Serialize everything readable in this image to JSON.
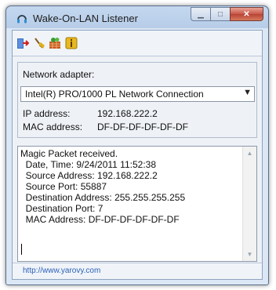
{
  "window": {
    "title": "Wake-On-LAN Listener",
    "caption_buttons": [
      "minimize",
      "maximize",
      "close"
    ]
  },
  "toolbar": {
    "icons": [
      "exit-icon",
      "clear-icon",
      "settings-icon",
      "about-icon"
    ]
  },
  "adapter": {
    "label": "Network adapter:",
    "selected": "Intel(R) PRO/1000 PL Network Connection",
    "ip_label": "IP address:",
    "ip_value": "192.168.222.2",
    "mac_label": "MAC address:",
    "mac_value": "DF-DF-DF-DF-DF-DF"
  },
  "log": {
    "lines": [
      "Magic Packet received.",
      "  Date, Time: 9/24/2011 11:52:38",
      "  Source Address: 192.168.222.2",
      "  Source Port: 55887",
      "  Destination Address: 255.255.255.255",
      "  Destination Port: 7",
      "  MAC Address: DF-DF-DF-DF-DF-DF"
    ]
  },
  "status": {
    "link": "http://www.yarovy.com"
  },
  "colors": {
    "accent": "#2a5fb5",
    "close_button": "#c75648"
  }
}
